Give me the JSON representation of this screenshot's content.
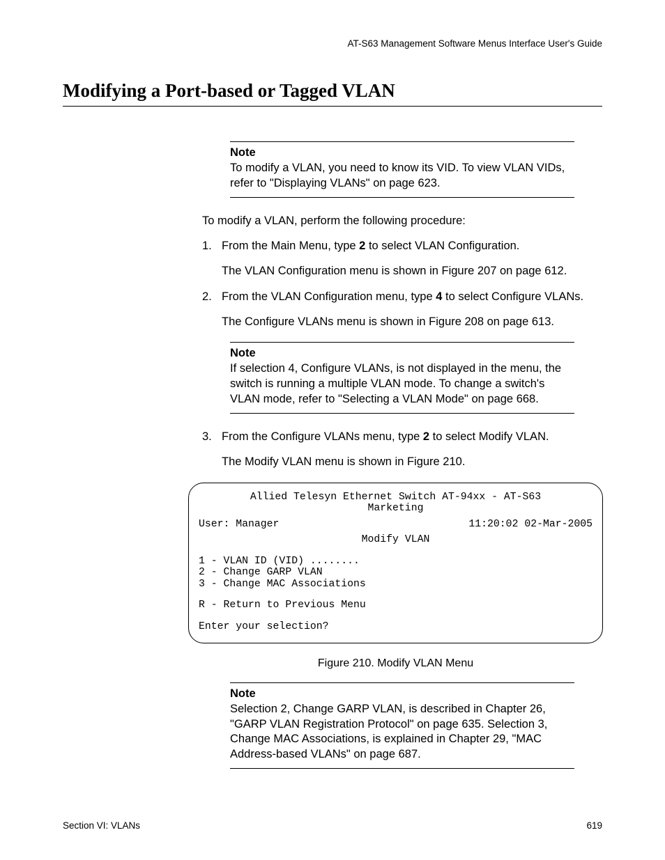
{
  "runningHeader": "AT-S63 Management Software Menus Interface User's Guide",
  "sectionHeading": "Modifying a Port-based or Tagged VLAN",
  "note1": {
    "label": "Note",
    "body": "To modify a VLAN, you need to know its VID. To view VLAN VIDs, refer to \"Displaying VLANs\" on page 623."
  },
  "intro": "To modify a VLAN, perform the following procedure:",
  "steps": {
    "s1": {
      "num": "1.",
      "pre": "From the Main Menu, type ",
      "bold": "2",
      "post": " to select VLAN Configuration.",
      "follow": "The VLAN Configuration menu is shown in Figure 207 on page 612."
    },
    "s2": {
      "num": "2.",
      "pre": "From the VLAN Configuration menu, type ",
      "bold": "4",
      "post": " to select Configure VLANs.",
      "follow": "The Configure VLANs menu is shown in Figure 208 on page 613."
    },
    "s3": {
      "num": "3.",
      "pre": "From the Configure VLANs menu, type ",
      "bold": "2",
      "post": " to select Modify VLAN.",
      "follow": "The Modify VLAN menu is shown in Figure 210."
    }
  },
  "note2": {
    "label": "Note",
    "body": "If selection 4, Configure VLANs, is not displayed in the menu, the switch is running a multiple VLAN mode. To change a switch's VLAN mode, refer to \"Selecting a VLAN Mode\" on page 668."
  },
  "terminal": {
    "l1": "Allied Telesyn Ethernet Switch AT-94xx - AT-S63",
    "l2": "Marketing",
    "l3left": "User: Manager",
    "l3right": "11:20:02 02-Mar-2005",
    "l4": "Modify VLAN",
    "l5": "1 - VLAN ID (VID) ........",
    "l6": "2 - Change GARP VLAN",
    "l7": "3 - Change MAC Associations",
    "l8": "R - Return to Previous Menu",
    "l9": "Enter your selection?"
  },
  "figureCaption": "Figure 210. Modify VLAN Menu",
  "note3": {
    "label": "Note",
    "body": "Selection 2, Change GARP VLAN, is described in Chapter 26, \"GARP VLAN Registration Protocol\" on page 635. Selection 3, Change MAC Associations, is explained in Chapter 29, \"MAC Address-based VLANs\" on page 687."
  },
  "footer": {
    "left": "Section VI: VLANs",
    "right": "619"
  }
}
